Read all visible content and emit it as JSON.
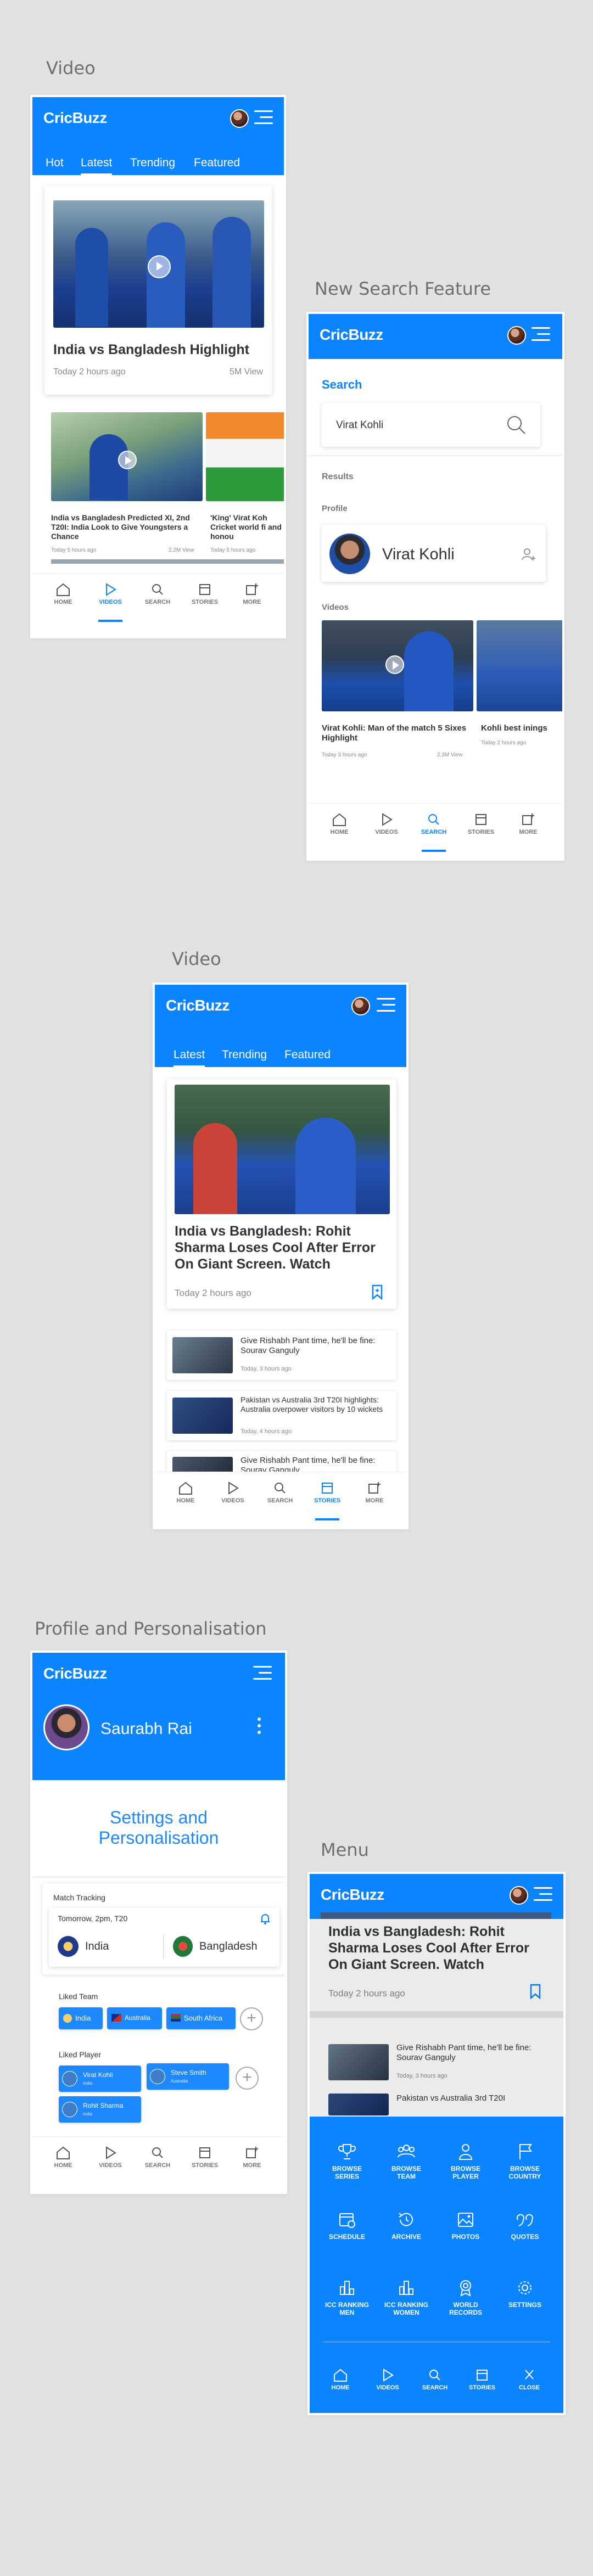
{
  "colors": {
    "brand": "#0a84ff",
    "bg": "#e2e2e2"
  },
  "app": {
    "brand": "CricBuzz"
  },
  "labels": {
    "video1": "Video",
    "search": "New Search Feature",
    "video2": "Video",
    "profile": "Profile and Personalisation",
    "menu": "Menu"
  },
  "nav": {
    "home": "HOME",
    "videos": "VIDEOS",
    "search": "SEARCH",
    "stories": "STORIES",
    "more": "MORE",
    "close": "CLOSE"
  },
  "video1": {
    "tabs": [
      "Hot",
      "Latest",
      "Trending",
      "Featured"
    ],
    "featured": {
      "title": "India vs Bangladesh Highlight",
      "time": "Today 2 hours ago",
      "views": "5M View"
    },
    "items": [
      {
        "title": "India vs Bangladesh Predicted XI, 2nd T20I: India Look to Give Youngsters a Chance",
        "time": "Today 5 hours ago",
        "views": "2.2M View"
      },
      {
        "title": "'King' Virat Koh Cricket world fi and honou",
        "time": "Today 5 hours ago"
      }
    ]
  },
  "search": {
    "heading": "Search",
    "query": "Virat Kohli",
    "results_label": "Results",
    "profile_label": "Profile",
    "profile_name": "Virat Kohli",
    "videos_label": "Videos",
    "videos": [
      {
        "title": "Virat Kohli: Man of the match 5 Sixes Highlight",
        "time": "Today 3 hours ago",
        "views": "2.3M View"
      },
      {
        "title": "Kohli best inings",
        "time": "Today 2 hours ago"
      }
    ]
  },
  "video2": {
    "tabs": [
      "Latest",
      "Trending",
      "Featured"
    ],
    "featured": {
      "title": "India vs Bangladesh: Rohit Sharma Loses Cool After Error On Giant Screen. Watch",
      "time": "Today 2 hours ago"
    },
    "news": [
      {
        "title": "Give Rishabh Pant time, he'll be fine: Sourav Ganguly",
        "time": "Today, 3 hours ago"
      },
      {
        "title": "Pakistan vs Australia 3rd T20I highlights: Australia overpower visitors by 10 wickets",
        "time": "Today, 4 hours ago"
      },
      {
        "title": "Give Rishabh Pant time, he'll be fine: Sourav Ganguly"
      }
    ]
  },
  "profile": {
    "name": "Saurabh Rai",
    "settings_title": "Settings and Personalisation",
    "match_tracking": "Match Tracking",
    "match_time": "Tomorrow, 2pm, T20",
    "team1": "India",
    "team2": "Bangladesh",
    "liked_team": "Liked Team",
    "teams": [
      "India",
      "Australia",
      "South Africa"
    ],
    "liked_player": "Liked Player",
    "players": [
      {
        "name": "Virat Kohli",
        "team": "India"
      },
      {
        "name": "Steve Smith",
        "team": "Australia"
      },
      {
        "name": "Rohit Sharma",
        "team": "India"
      }
    ]
  },
  "menu": {
    "bg_title": "India vs Bangladesh: Rohit Sharma Loses Cool After Error On Giant Screen. Watch",
    "bg_time": "Today 2 hours ago",
    "bg_news": [
      {
        "title": "Give Rishabh Pant time, he'll be fine: Sourav Ganguly",
        "time": "Today, 3 hours ago"
      },
      {
        "title": "Pakistan vs Australia 3rd T20I"
      }
    ],
    "items": [
      [
        "BROWSE",
        "SERIES"
      ],
      [
        "BROWSE",
        "TEAM"
      ],
      [
        "BROWSE",
        "PLAYER"
      ],
      [
        "BROWSE",
        "COUNTRY"
      ],
      [
        "SCHEDULE"
      ],
      [
        "ARCHIVE"
      ],
      [
        "PHOTOS"
      ],
      [
        "QUOTES"
      ],
      [
        "ICC RANKING",
        "MEN"
      ],
      [
        "ICC RANKING",
        "WOMEN"
      ],
      [
        "WORLD",
        "RECORDS"
      ],
      [
        "SETTINGS"
      ]
    ]
  }
}
